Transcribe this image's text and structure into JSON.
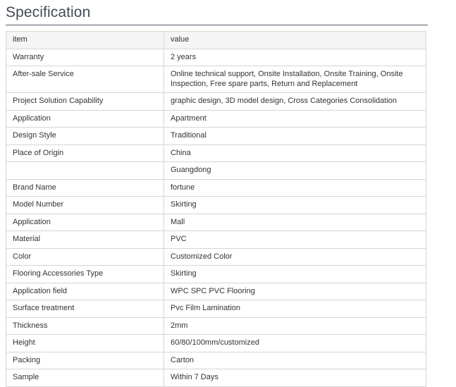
{
  "title": "Specification",
  "table": {
    "header": {
      "item": "item",
      "value": "value"
    },
    "rows": [
      {
        "item": "Warranty",
        "value": "2 years"
      },
      {
        "item": "After-sale Service",
        "value": "Online technical support, Onsite Installation, Onsite Training, Onsite Inspection, Free spare parts, Return and Replacement"
      },
      {
        "item": "Project Solution Capability",
        "value": "graphic design, 3D model design, Cross Categories Consolidation"
      },
      {
        "item": "Application",
        "value": "Apartment"
      },
      {
        "item": "Design Style",
        "value": "Traditional"
      },
      {
        "item": "Place of Origin",
        "value": "China"
      },
      {
        "item": "",
        "value": "Guangdong"
      },
      {
        "item": "Brand Name",
        "value": "fortune"
      },
      {
        "item": "Model Number",
        "value": "Skirting"
      },
      {
        "item": "Application",
        "value": "Mall"
      },
      {
        "item": "Material",
        "value": "PVC"
      },
      {
        "item": "Color",
        "value": "Customized Color"
      },
      {
        "item": "Flooring Accessories Type",
        "value": "Skirting"
      },
      {
        "item": "Application field",
        "value": "WPC SPC PVC Flooring"
      },
      {
        "item": "Surface treatment",
        "value": "Pvc Film Lamination"
      },
      {
        "item": "Thickness",
        "value": "2mm"
      },
      {
        "item": "Height",
        "value": "60/80/100mm/customized"
      },
      {
        "item": "Packing",
        "value": "Carton"
      },
      {
        "item": "Sample",
        "value": "Within 7 Days"
      }
    ]
  }
}
